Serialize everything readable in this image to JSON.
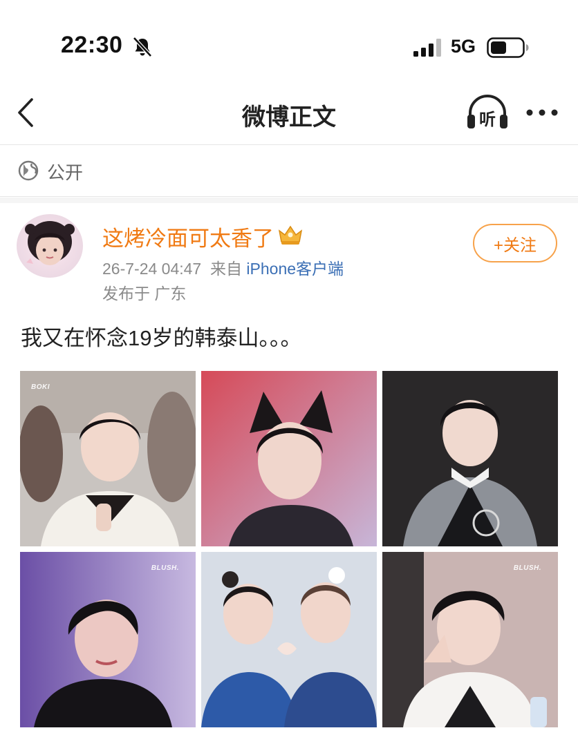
{
  "status_bar": {
    "time": "22:30",
    "network": "5G",
    "icons": [
      "bell-slash-icon",
      "signal-icon",
      "battery-icon"
    ]
  },
  "nav": {
    "title": "微博正文",
    "listen_label": "听",
    "icons": [
      "chevron-left-icon",
      "headphones-icon",
      "more-icon"
    ]
  },
  "visibility": {
    "label": "公开",
    "icon": "globe-icon"
  },
  "post": {
    "username": "这烤冷面可太香了",
    "badge_icon": "crown-icon",
    "date": "26-7-24 04:47",
    "source_prefix": "来自",
    "client": "iPhone客户端",
    "location": "发布于 广东",
    "follow_label": "+关注",
    "text": "我又在怀念19岁的韩泰山。。。",
    "photo_watermarks": [
      "BOKI",
      "",
      "",
      "BLUSH.",
      "",
      "BLUSH."
    ]
  },
  "colors": {
    "username": "#f07a13",
    "follow_border": "#f7a24a",
    "client_link": "#3b6fb5",
    "meta": "#8a8a8a"
  }
}
